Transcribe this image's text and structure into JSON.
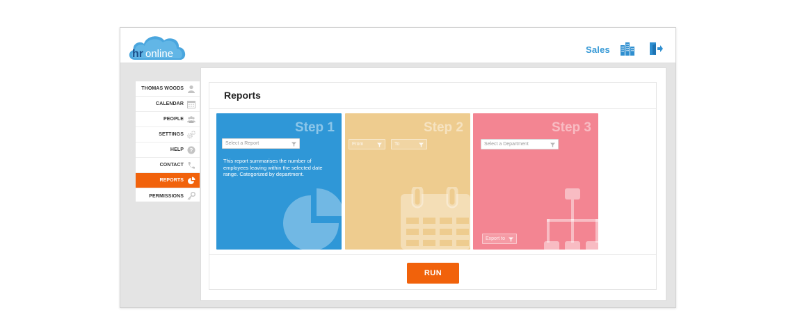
{
  "header": {
    "logo_text": "hronline",
    "account_name": "Sales",
    "icons": {
      "buildings": "buildings-icon",
      "logout": "logout-icon"
    },
    "accent_color": "#3699d6"
  },
  "sidebar": {
    "items": [
      {
        "label": "THOMAS WOODS",
        "icon": "user-icon",
        "active": false
      },
      {
        "label": "CALENDAR",
        "icon": "calendar-icon",
        "active": false
      },
      {
        "label": "PEOPLE",
        "icon": "people-icon",
        "active": false
      },
      {
        "label": "SETTINGS",
        "icon": "gears-icon",
        "active": false
      },
      {
        "label": "HELP",
        "icon": "help-icon",
        "active": false
      },
      {
        "label": "CONTACT",
        "icon": "phone-icon",
        "active": false
      },
      {
        "label": "REPORTS",
        "icon": "pie-chart-icon",
        "active": true
      },
      {
        "label": "PERMISSIONS",
        "icon": "key-icon",
        "active": false
      }
    ],
    "active_color": "#f1620b"
  },
  "main": {
    "title": "Reports",
    "run_label": "RUN",
    "steps": [
      {
        "title": "Step 1",
        "color": "#2f97d7",
        "select_report_placeholder": "Select a Report",
        "description": "This report summarises the number of employees leaving within the selected date range. Categorized  by department.",
        "icon": "pie-chart-icon"
      },
      {
        "title": "Step 2",
        "color": "#eecc8f",
        "from_placeholder": "From",
        "to_placeholder": "To",
        "icon": "calendar-icon"
      },
      {
        "title": "Step 3",
        "color": "#f38592",
        "department_placeholder": "Select a Department",
        "export_placeholder": "Export to",
        "icon": "org-chart-icon"
      }
    ]
  }
}
